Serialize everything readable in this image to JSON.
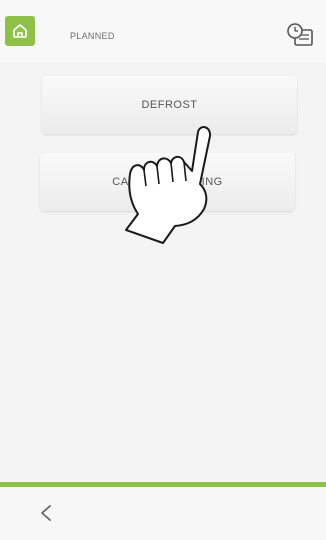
{
  "header": {
    "title": "PLANNED",
    "home_icon": "home-icon",
    "clock_icon": "clock-card-icon"
  },
  "menu": {
    "defrost_label": "DEFROST",
    "cabinet_label": "CABINET LIGHTING"
  },
  "footer": {
    "back_icon": "chevron-left-icon"
  },
  "colors": {
    "accent_green": "#8ec04a",
    "background": "#f4f4f4"
  }
}
